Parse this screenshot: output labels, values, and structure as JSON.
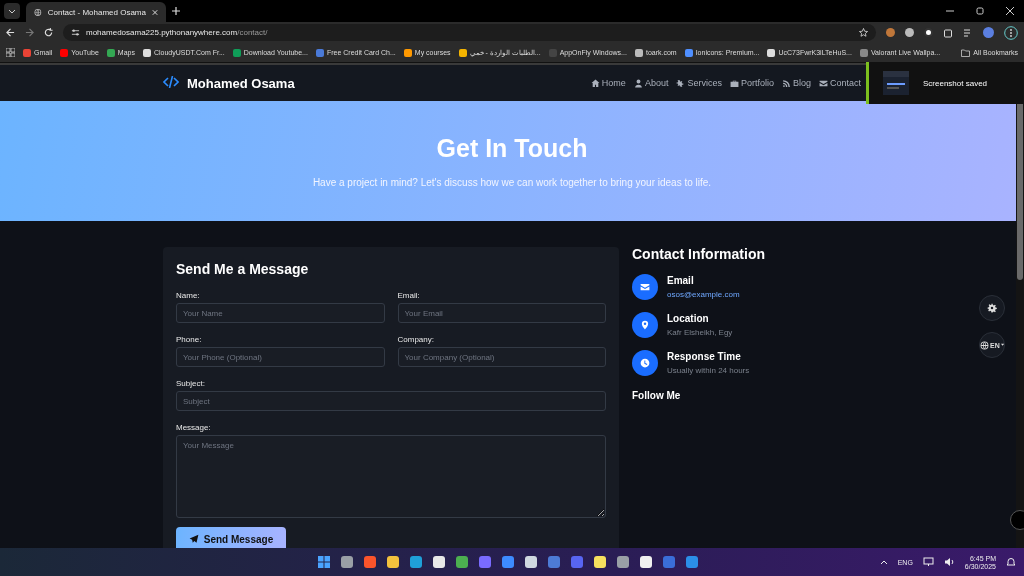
{
  "browser": {
    "tab_title": "Contact - Mohamed Osama",
    "url_host": "mohamedosama225.pythonanywhere.com",
    "url_path": "/contact/",
    "bookmarks": [
      "Gmail",
      "YouTube",
      "Maps",
      "CloudyUSDT.Com Fr...",
      "Download Youtube...",
      "Free Credit Card Ch...",
      "My courses",
      "الطلبات الواردة - خمي...",
      "AppOnFly Windows...",
      "toark.com",
      "Ionicons: Premium...",
      "UcC73FwrK3iLTeHuS...",
      "Valorant Live Wallpa..."
    ],
    "all_bookmarks": "All Bookmarks"
  },
  "toast": {
    "text": "Screenshot saved"
  },
  "site": {
    "logo": "Mohamed Osama",
    "nav": [
      {
        "label": "Home",
        "kind": "home"
      },
      {
        "label": "About",
        "kind": "user"
      },
      {
        "label": "Services",
        "kind": "gears"
      },
      {
        "label": "Portfolio",
        "kind": "briefcase"
      },
      {
        "label": "Blog",
        "kind": "blog"
      },
      {
        "label": "Contact",
        "kind": "mail"
      }
    ],
    "hero": {
      "title": "Get In Touch",
      "subtitle": "Have a project in mind? Let's discuss how we can work together to bring your ideas to life."
    },
    "form": {
      "title": "Send Me a Message",
      "rows": [
        [
          {
            "label": "Name:",
            "placeholder": "Your Name",
            "kind": "input"
          },
          {
            "label": "Email:",
            "placeholder": "Your Email",
            "kind": "input"
          }
        ],
        [
          {
            "label": "Phone:",
            "placeholder": "Your Phone (Optional)",
            "kind": "input"
          },
          {
            "label": "Company:",
            "placeholder": "Your Company (Optional)",
            "kind": "input"
          }
        ],
        [
          {
            "label": "Subject:",
            "placeholder": "Subject",
            "kind": "input"
          }
        ],
        [
          {
            "label": "Message:",
            "placeholder": "Your Message",
            "kind": "textarea"
          }
        ]
      ],
      "submit": "Send Message"
    },
    "info": {
      "title": "Contact Information",
      "items": [
        {
          "kind": "mail",
          "title": "Email",
          "value": "osos@example.com",
          "link": true
        },
        {
          "kind": "pin",
          "title": "Location",
          "value": "Kafr Elsheikh, Egy",
          "link": false
        },
        {
          "kind": "clock",
          "title": "Response Time",
          "value": "Usually within 24 hours",
          "link": false
        }
      ],
      "follow": "Follow Me"
    },
    "language": "EN"
  },
  "taskbar": {
    "language": "ENG",
    "time": "6:45 PM",
    "date": "6/30/2025"
  }
}
